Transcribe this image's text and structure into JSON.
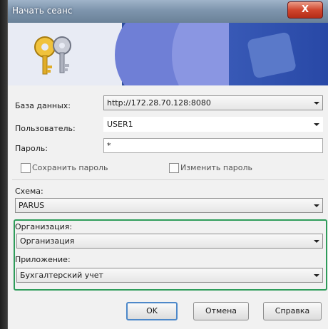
{
  "window": {
    "title": "Начать сеанс",
    "close_glyph": "X"
  },
  "banner": {
    "icon": "keys-icon"
  },
  "form": {
    "database": {
      "label": "База данных:",
      "value": "http://172.28.70.128:8080"
    },
    "user": {
      "label": "Пользователь:",
      "value": "USER1"
    },
    "password": {
      "label": "Пароль:",
      "value": "*"
    },
    "save_password": {
      "label": "Сохранить пароль",
      "checked": false
    },
    "change_password": {
      "label": "Изменить пароль",
      "checked": false
    },
    "schema": {
      "label": "Схема:",
      "value": "PARUS"
    },
    "organization": {
      "label": "Организация:",
      "value": "Организация"
    },
    "application": {
      "label": "Приложение:",
      "value": "Бухгалтерский учет"
    }
  },
  "buttons": {
    "ok": "OK",
    "cancel": "Отмена",
    "help": "Справка"
  },
  "colors": {
    "highlight_border": "#2e9c5a",
    "default_button_border": "#4d88c9"
  }
}
